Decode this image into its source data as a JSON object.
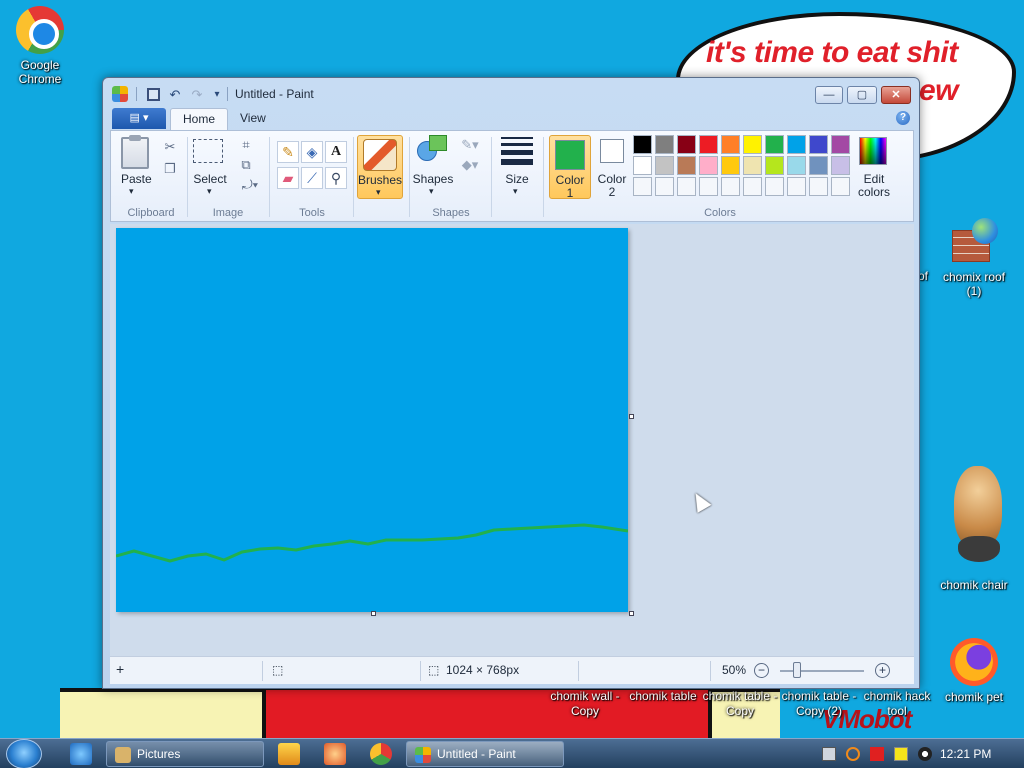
{
  "wallpaper": {
    "bubble_line1": "it's time to eat shit",
    "bubble_line2": "ew",
    "signature": "VMobot"
  },
  "desktop_icons": {
    "chrome": "Google Chrome",
    "chomik_roof": "chomix roof (1)",
    "partial_label": "of",
    "chomik_chair": "chomik chair",
    "chomik_pet": "chomik pet",
    "bottom_row": [
      "chomik wall - Copy",
      "chomik table",
      "chomik table - Copy",
      "chomik table - Copy (2)",
      "chomik hack tool"
    ]
  },
  "window": {
    "title": "Untitled - Paint",
    "file_tab": "▤ ▾",
    "tabs": [
      "Home",
      "View"
    ],
    "active_tab": "Home",
    "help": "?",
    "controls": {
      "minimize": "—",
      "maximize": "▢",
      "close": "✕"
    }
  },
  "ribbon": {
    "clipboard": {
      "paste": "Paste",
      "group": "Clipboard"
    },
    "image": {
      "select": "Select",
      "group": "Image"
    },
    "tools": {
      "group": "Tools",
      "text_tool": "A"
    },
    "brushes": {
      "label": "Brushes"
    },
    "shapes": {
      "label": "Shapes",
      "group": "Shapes"
    },
    "size": {
      "label": "Size"
    },
    "colors": {
      "color1_label": "Color\n1",
      "color2_label": "Color\n2",
      "color1_value": "#22b14c",
      "color2_value": "#ffffff",
      "edit_colors": "Edit\ncolors",
      "group": "Colors",
      "palette_row1": [
        "#000000",
        "#7f7f7f",
        "#880015",
        "#ed1c24",
        "#ff7f27",
        "#fff200",
        "#22b14c",
        "#00a2e8",
        "#3f48cc",
        "#a349a4"
      ],
      "palette_row2": [
        "#ffffff",
        "#c3c3c3",
        "#b97a57",
        "#ffaec9",
        "#ffc90e",
        "#efe4b0",
        "#b5e61d",
        "#99d9ea",
        "#7092be",
        "#c8bfe7"
      ],
      "palette_row3": [
        "",
        "",
        "",
        "",
        "",
        "",
        "",
        "",
        "",
        ""
      ]
    }
  },
  "canvas": {
    "background": "#00a2e8",
    "stroke_color": "#22b14c"
  },
  "statusbar": {
    "add": "+",
    "dimensions": "1024 × 768px",
    "zoom": "50%",
    "zoom_out": "−",
    "zoom_in": "+",
    "zoom_level": 0.5
  },
  "taskbar": {
    "pictures": "Pictures",
    "paint": "Untitled - Paint",
    "clock": "12:21 PM"
  }
}
